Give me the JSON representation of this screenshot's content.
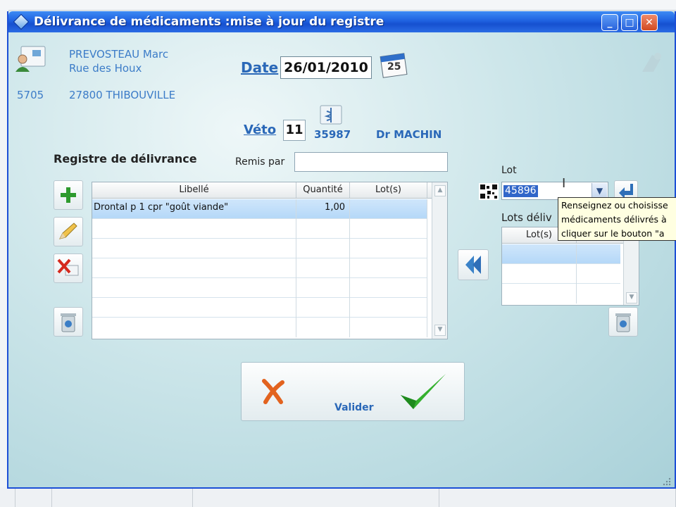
{
  "window": {
    "title": "Délivrance de médicaments :mise à jour du registre",
    "controls": {
      "minimize": "_",
      "maximize": "□",
      "close": "✕"
    }
  },
  "client": {
    "name": "PREVOSTEAU Marc",
    "street": "Rue des Houx",
    "id": "5705",
    "city": "27800 THIBOUVILLE"
  },
  "date": {
    "label": "Date",
    "value": "26/01/2010",
    "calendar_day": "25"
  },
  "veto": {
    "label": "Véto",
    "code": "11",
    "number": "35987",
    "name": "Dr MACHIN"
  },
  "registre": {
    "title": "Registre de délivrance",
    "remis_label": "Remis par",
    "remis_value": "",
    "columns": [
      "Libellé",
      "Quantité",
      "Lot(s)"
    ],
    "rows": [
      {
        "libelle": "Drontal p 1 cpr \"goût viande\"",
        "quantite": "1,00",
        "lots": ""
      }
    ]
  },
  "lot": {
    "label": "Lot",
    "value": "45896",
    "delivered_label": "Lots déliv",
    "delivered_columns": [
      "Lot(s)",
      ""
    ]
  },
  "tooltip": {
    "lines": [
      "Renseignez ou choisisse",
      "médicaments délivrés à",
      "cliquer sur le bouton \"a"
    ]
  },
  "actions": {
    "validate_label": "Valider"
  },
  "colors": {
    "titlebar": "#1f62e0",
    "accent_blue": "#3c7cc8",
    "selection": "#b5d8f8",
    "green_plus": "#2e9a2e",
    "red_cancel": "#d9541e"
  }
}
